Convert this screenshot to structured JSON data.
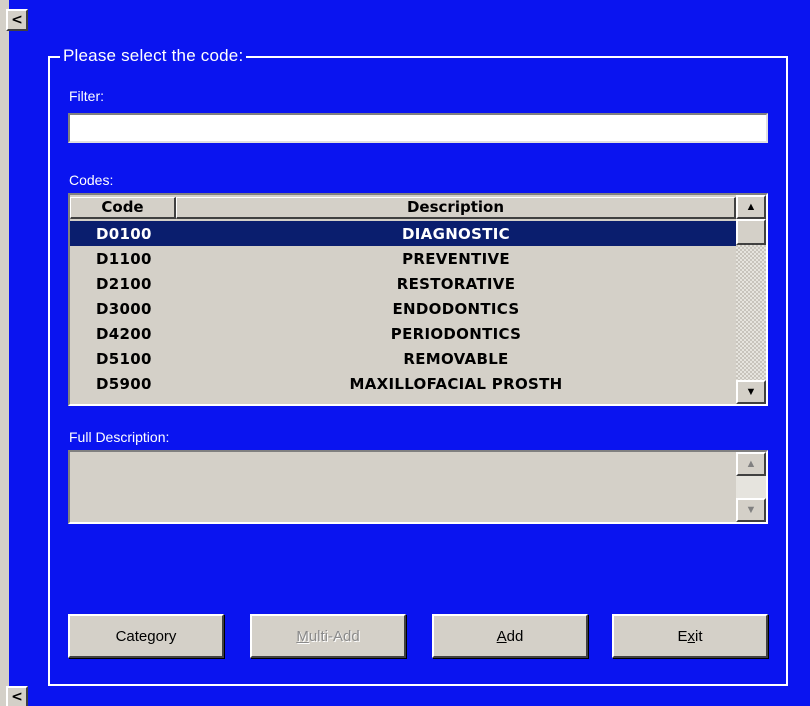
{
  "window": {
    "nav_left_top": "<",
    "nav_left_bottom": "<"
  },
  "group": {
    "title": "Please select the code:"
  },
  "filter": {
    "label": "Filter:",
    "value": "",
    "placeholder": ""
  },
  "codes": {
    "label": "Codes:",
    "columns": [
      "Code",
      "Description"
    ],
    "rows": [
      {
        "code": "D0100",
        "description": "DIAGNOSTIC",
        "selected": true
      },
      {
        "code": "D1100",
        "description": "PREVENTIVE",
        "selected": false
      },
      {
        "code": "D2100",
        "description": "RESTORATIVE",
        "selected": false
      },
      {
        "code": "D3000",
        "description": "ENDODONTICS",
        "selected": false
      },
      {
        "code": "D4200",
        "description": "PERIODONTICS",
        "selected": false
      },
      {
        "code": "D5100",
        "description": "REMOVABLE",
        "selected": false
      },
      {
        "code": "D5900",
        "description": "MAXILLOFACIAL PROSTH",
        "selected": false
      }
    ],
    "scroll_up_icon": "arrow-up-icon",
    "scroll_down_icon": "arrow-down-icon"
  },
  "full_description": {
    "label": "Full Description:",
    "value": ""
  },
  "buttons": {
    "category": {
      "pre": "",
      "key": "",
      "post": "Category",
      "enabled": true
    },
    "multi_add": {
      "pre": "",
      "key": "M",
      "post": "ulti-Add",
      "enabled": false
    },
    "add": {
      "pre": "",
      "key": "A",
      "post": "dd",
      "enabled": true
    },
    "exit": {
      "pre": "E",
      "key": "x",
      "post": "it",
      "enabled": true
    }
  },
  "colors": {
    "background": "#0a14f0",
    "selection": "#0a1e6e",
    "control_face": "#d4d0c8"
  }
}
